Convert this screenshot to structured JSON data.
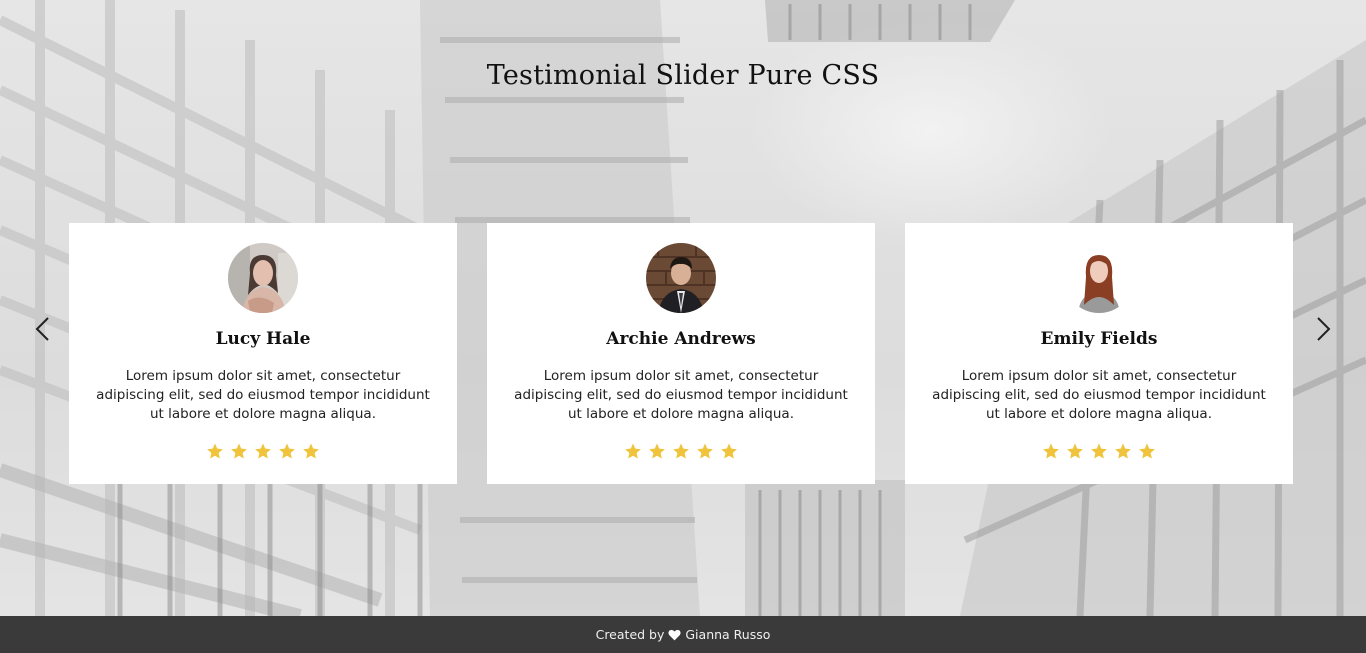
{
  "page": {
    "title": "Testimonial Slider Pure CSS"
  },
  "navigation": {
    "prev_icon": "chevron-left-icon",
    "next_icon": "chevron-right-icon"
  },
  "testimonials": [
    {
      "name": "Lucy Hale",
      "text": "Lorem ipsum dolor sit amet, consectetur adipiscing elit, sed do eiusmod tempor incididunt ut labore et dolore magna aliqua.",
      "rating": 5
    },
    {
      "name": "Archie Andrews",
      "text": "Lorem ipsum dolor sit amet, consectetur adipiscing elit, sed do eiusmod tempor incididunt ut labore et dolore magna aliqua.",
      "rating": 5
    },
    {
      "name": "Emily Fields",
      "text": "Lorem ipsum dolor sit amet, consectetur adipiscing elit, sed do eiusmod tempor incididunt ut labore et dolore magna aliqua.",
      "rating": 5
    }
  ],
  "footer": {
    "prefix": "Created by",
    "author": "Gianna Russo",
    "icon": "heart-icon"
  },
  "colors": {
    "star": "#f0c33c",
    "footer_bg": "#3a3a3a"
  }
}
